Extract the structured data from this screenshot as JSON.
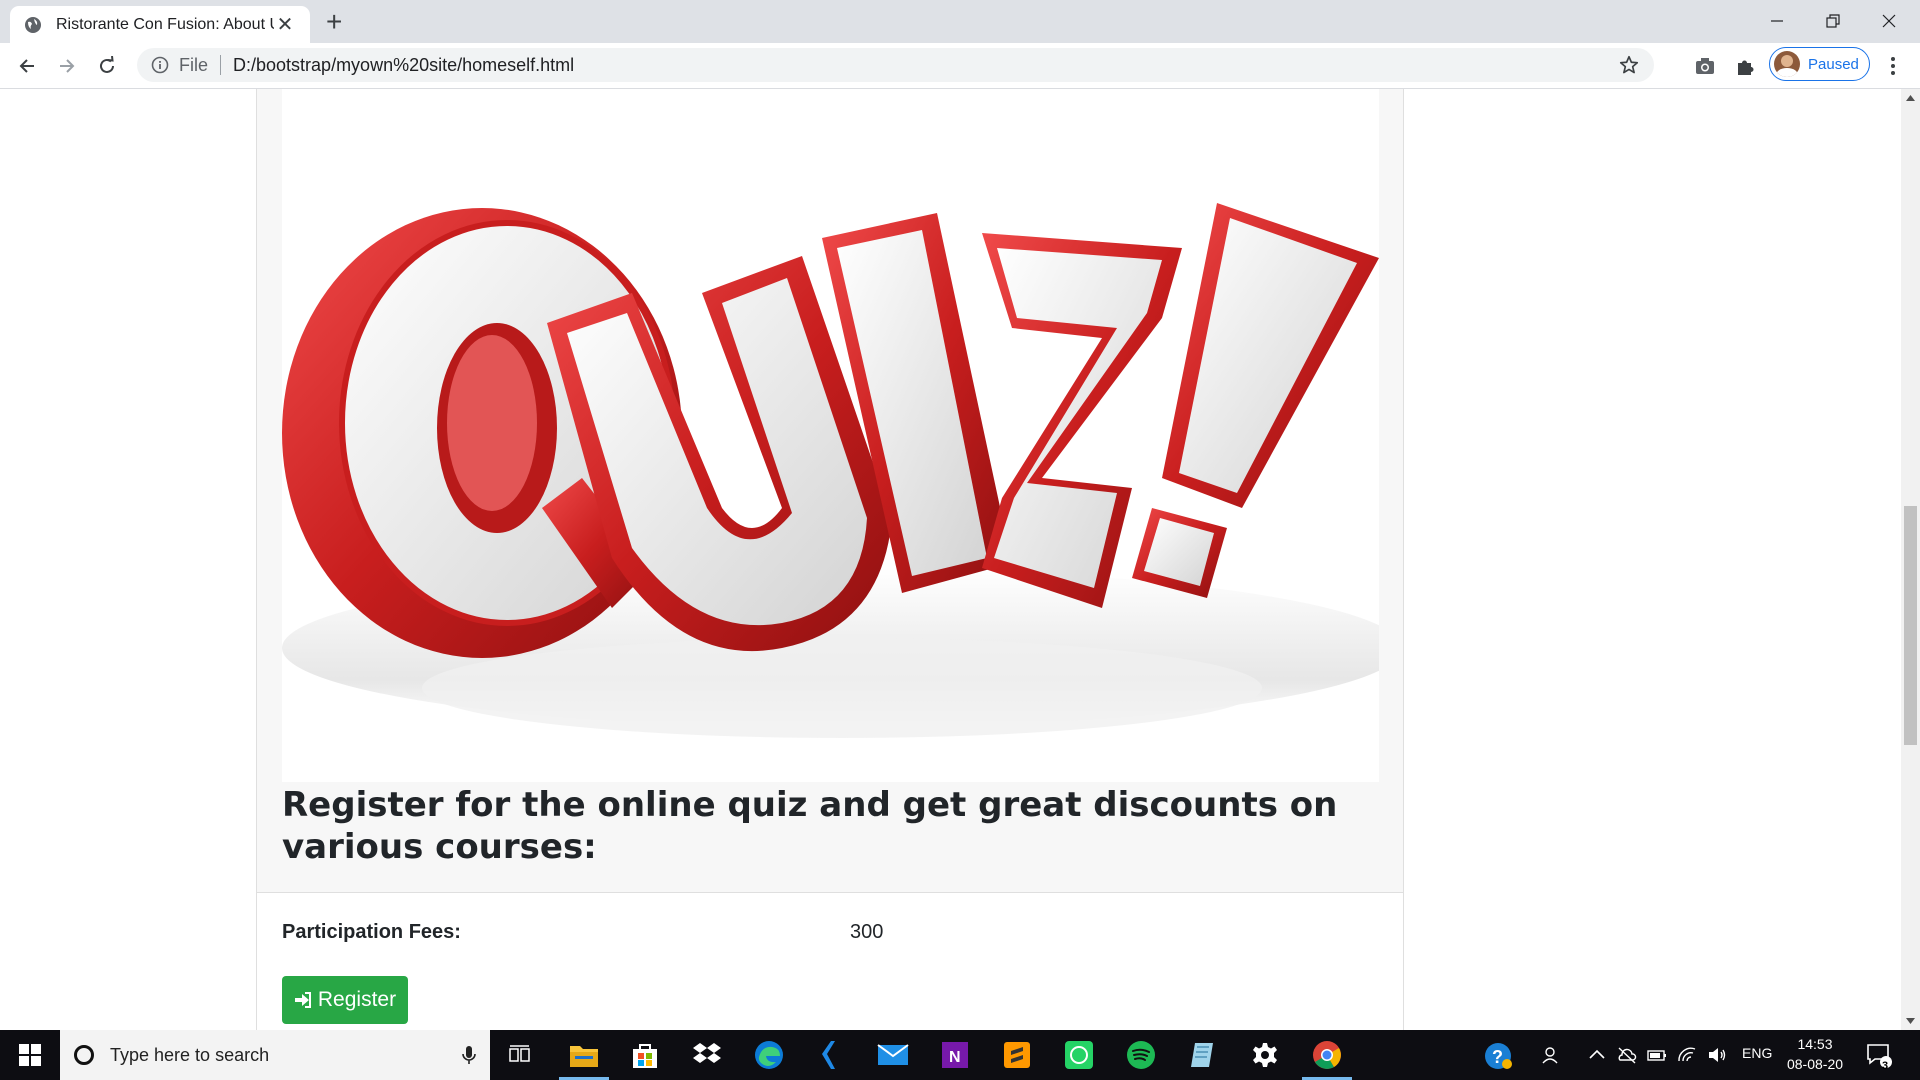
{
  "browser": {
    "tab_title": "Ristorante Con Fusion: About Us",
    "tab_close": "✕",
    "new_tab": "+",
    "scheme": "File",
    "url": "D:/bootstrap/myown%20site/homeself.html",
    "profile_status": "Paused"
  },
  "page": {
    "image_alt": "QUIZ!",
    "heading": "Register for the online quiz and get great discounts on various courses:",
    "fees_label": "Participation Fees:",
    "fees_value": "300",
    "register_button": "Register"
  },
  "taskbar": {
    "search_placeholder": "Type here to search",
    "apps": [
      "file-explorer",
      "microsoft-store",
      "dropbox",
      "edge",
      "visual-studio",
      "mail",
      "onenote",
      "sublime-text",
      "whatsapp",
      "spotify",
      "notepad",
      "settings",
      "chrome"
    ],
    "language": "ENG",
    "time": "14:53",
    "date": "08-08-20",
    "notification_count": "3"
  },
  "colors": {
    "register_green": "#28a745",
    "quiz_red": "#d42a2a",
    "taskbar_bg": "#0d0d12",
    "accent_blue": "#1a73e8"
  }
}
